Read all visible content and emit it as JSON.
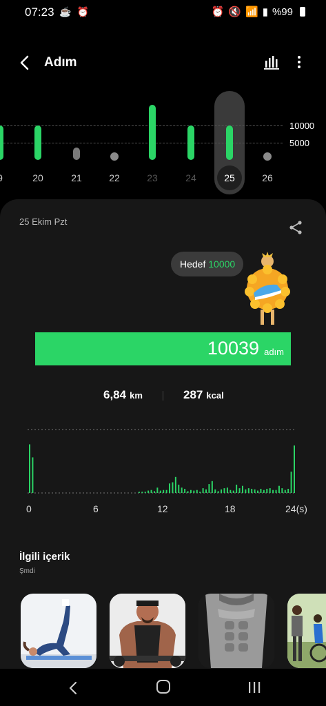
{
  "status": {
    "time": "07:23",
    "battery": "%99"
  },
  "header": {
    "title": "Adım"
  },
  "trend": {
    "goal_high": "10000",
    "goal_low": "5000",
    "days": [
      {
        "label": "9",
        "state": "partial"
      },
      {
        "label": "20",
        "state": "goal"
      },
      {
        "label": "21",
        "state": "low"
      },
      {
        "label": "22",
        "state": "none"
      },
      {
        "label": "23",
        "state": "goal"
      },
      {
        "label": "24",
        "state": "goal"
      },
      {
        "label": "25",
        "state": "selected"
      },
      {
        "label": "26",
        "state": "none"
      }
    ]
  },
  "summary": {
    "date": "25 Ekim Pzt",
    "goal_label": "Hedef",
    "goal_value": "10000",
    "steps": "10039",
    "steps_unit": "adım",
    "distance": "6,84",
    "distance_unit": "km",
    "calories": "287",
    "calories_unit": "kcal"
  },
  "hourly_chart": {
    "x_labels": [
      "0",
      "6",
      "12",
      "18",
      "24(s)"
    ]
  },
  "chart_data": {
    "type": "bar",
    "title": "",
    "xlabel": "",
    "ylabel": "",
    "x_ticks": [
      "0",
      "6",
      "12",
      "18",
      "24(s)"
    ],
    "x_range": [
      0,
      24
    ],
    "values": [
      0.82,
      0.6,
      0,
      0,
      0,
      0,
      0,
      0,
      0,
      0,
      0,
      0,
      0,
      0,
      0,
      0,
      0,
      0,
      0,
      0,
      0,
      0,
      0,
      0,
      0,
      0,
      0,
      0,
      0,
      0,
      0,
      0,
      0,
      0,
      0,
      0,
      0.02,
      0.02,
      0.02,
      0.04,
      0.05,
      0.03,
      0.09,
      0.04,
      0.05,
      0.05,
      0.16,
      0.18,
      0.27,
      0.14,
      0.09,
      0.07,
      0.03,
      0.05,
      0.04,
      0.05,
      0.02,
      0.08,
      0.06,
      0.15,
      0.2,
      0.06,
      0.03,
      0.06,
      0.08,
      0.09,
      0.05,
      0.04,
      0.14,
      0.08,
      0.12,
      0.06,
      0.08,
      0.07,
      0.06,
      0.04,
      0.07,
      0.05,
      0.07,
      0.08,
      0.05,
      0.05,
      0.12,
      0.08,
      0.05,
      0.07,
      0.36,
      0.8
    ]
  },
  "related": {
    "title": "İlgili içerik",
    "subtitle": "Şmdi"
  },
  "colors": {
    "accent": "#2bd566",
    "card": "#171717",
    "background": "#000000"
  }
}
